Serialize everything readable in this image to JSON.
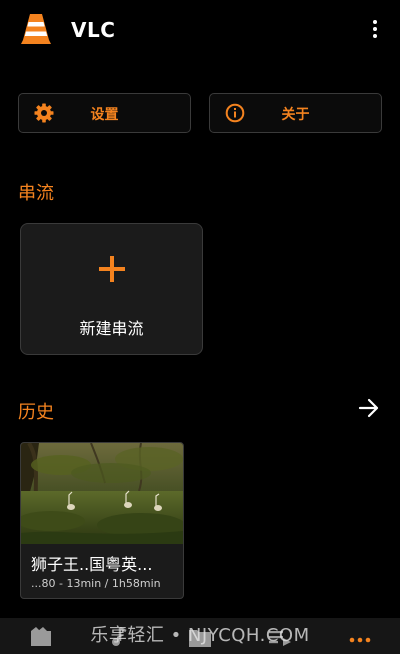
{
  "app": {
    "title": "VLC"
  },
  "buttons": {
    "settings_label": "设置",
    "about_label": "关于"
  },
  "sections": {
    "stream_title": "串流",
    "history_title": "历史"
  },
  "new_stream": {
    "label": "新建串流"
  },
  "history": {
    "items": [
      {
        "title": "狮子王..国粤英...",
        "subtitle": "...80 - 13min / 1h58min"
      }
    ]
  },
  "watermark": "乐享轻汇 • NJYCQH.COM",
  "colors": {
    "accent": "#f4831f",
    "background": "#000000",
    "card": "#1b1b1b",
    "border": "#3a3a3a"
  },
  "icons": {
    "logo": "vlc-cone-icon",
    "menu": "more-vert-icon",
    "settings": "gear-icon",
    "about": "info-icon",
    "add": "plus-icon",
    "history_more": "arrow-right-icon",
    "nav": [
      "video-icon",
      "audio-icon",
      "browse-icon",
      "playlists-icon",
      "more-horiz-icon"
    ]
  },
  "bottom_nav": {
    "active_index": 4
  }
}
